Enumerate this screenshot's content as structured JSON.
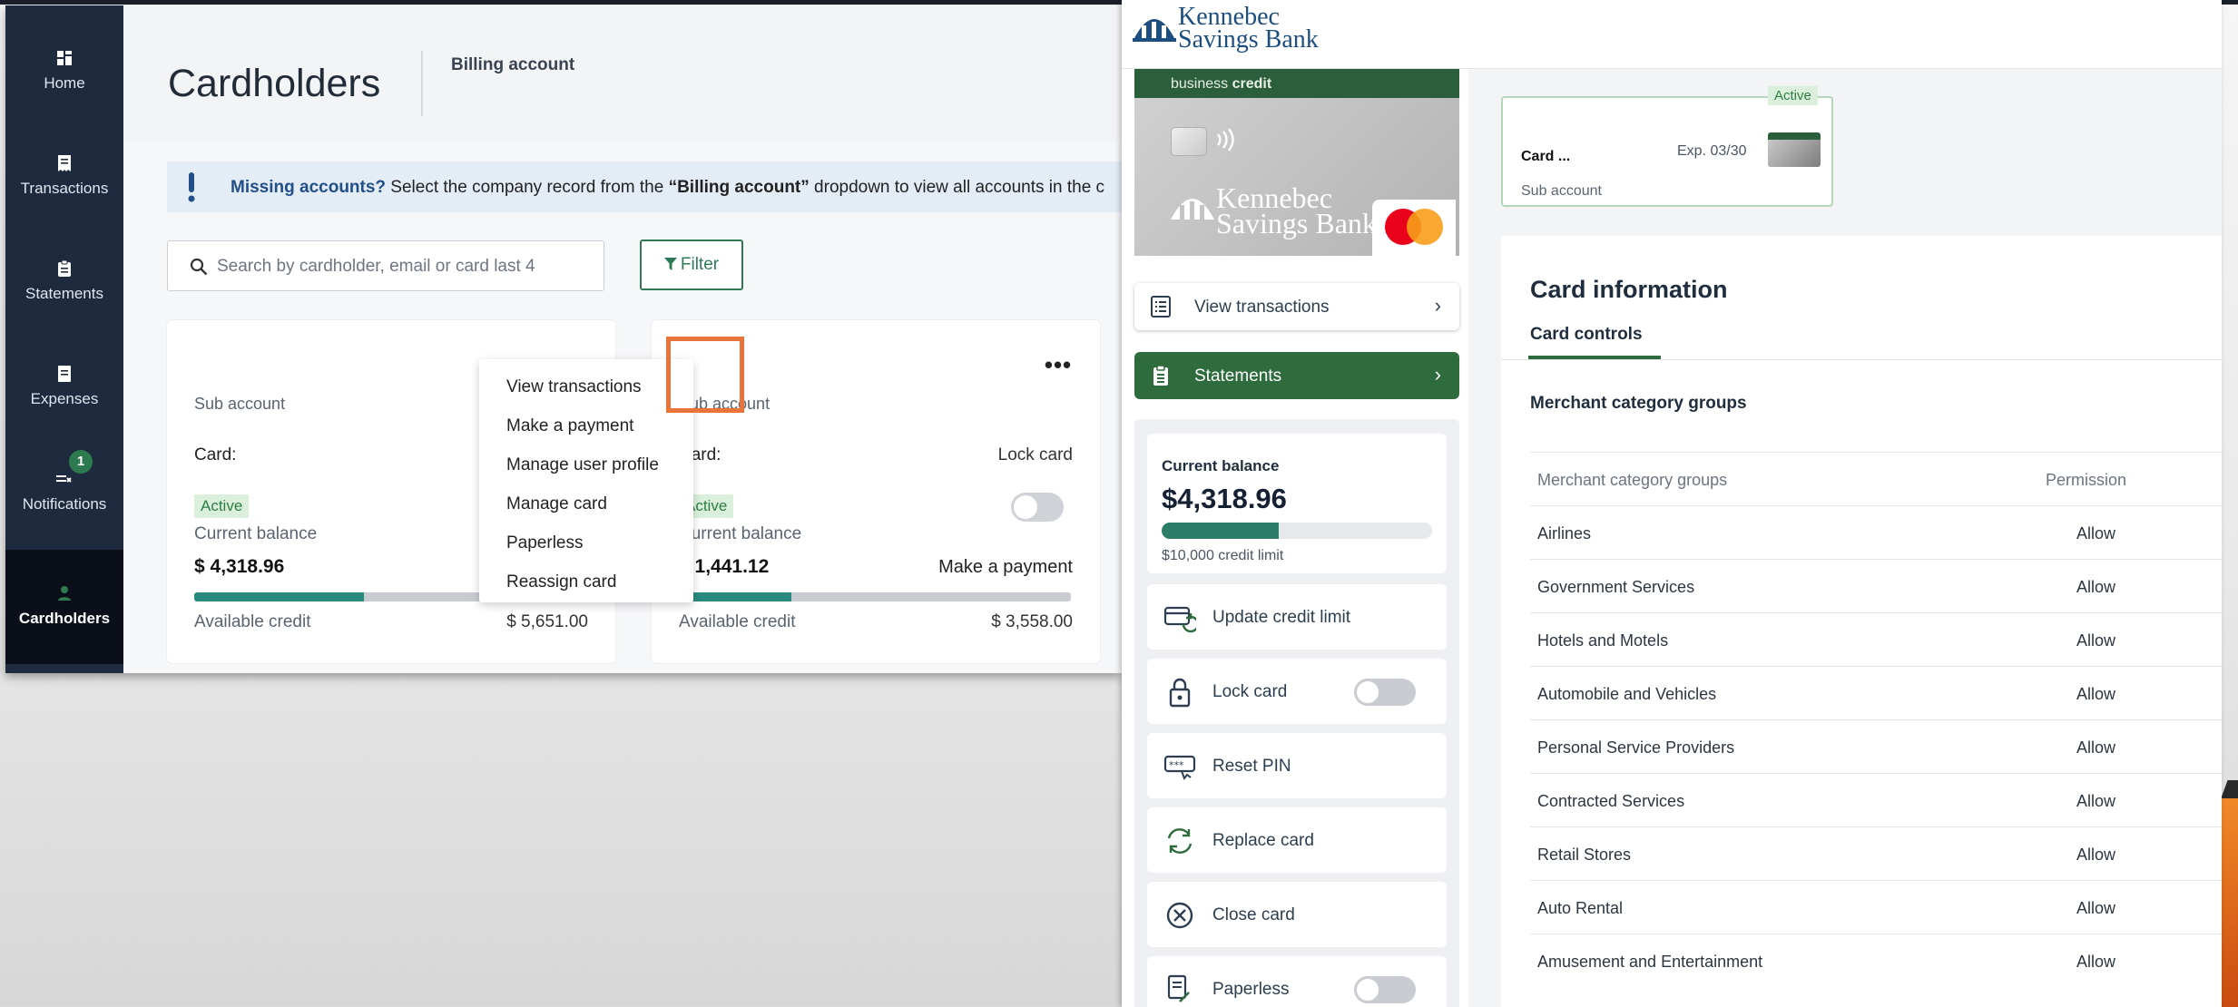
{
  "sidebar": {
    "items": [
      {
        "label": "Home",
        "icon": "dashboard-icon"
      },
      {
        "label": "Transactions",
        "icon": "receipt-icon"
      },
      {
        "label": "Statements",
        "icon": "clipboard-icon"
      },
      {
        "label": "Expenses",
        "icon": "document-icon"
      },
      {
        "label": "Notifications",
        "icon": "bell-list-icon",
        "badge": "1"
      },
      {
        "label": "Cardholders",
        "icon": "people-icon",
        "selected": true
      }
    ]
  },
  "header": {
    "title": "Cardholders",
    "billing_label": "Billing account"
  },
  "banner": {
    "bold1": "Missing accounts?",
    "text1": " Select the company record from the ",
    "bold2": "“Billing account”",
    "text2": " dropdown to view all accounts in the c"
  },
  "search": {
    "placeholder": "Search by cardholder, email or card last 4"
  },
  "filter": {
    "label": "Filter"
  },
  "cards": [
    {
      "sub": "Sub account",
      "card_label": "Card:",
      "lock_label": "ard",
      "status": "Active",
      "balance_label": "Current balance",
      "balance": "$ 4,318.96",
      "payment_label": "ent",
      "available_label": "Available credit",
      "available": "$ 5,651.00",
      "fill_fraction": 0.433
    },
    {
      "sub": "Sub account",
      "card_label": "Card:",
      "lock_label": "Lock card",
      "status": "Active",
      "balance_label": "Current balance",
      "balance": "$ 1,441.12",
      "payment_label": "Make a payment",
      "available_label": "Available credit",
      "available": "$ 3,558.00",
      "fill_fraction": 0.288
    }
  ],
  "menu": {
    "items": [
      "View transactions",
      "Make a payment",
      "Manage user profile",
      "Manage card",
      "Paperless",
      "Reassign card"
    ]
  },
  "more_label": "•••",
  "bank": {
    "name_line1": "Kennebec",
    "name_line2": "Savings Bank"
  },
  "credit_card": {
    "band_label": "business",
    "band_bold": "credit",
    "network": "mastercard"
  },
  "right_nav": {
    "view_transactions": "View transactions",
    "statements": "Statements",
    "chevron": "›"
  },
  "balance_tile": {
    "label": "Current balance",
    "value": "$4,318.96",
    "limit": "$10,000 credit limit",
    "fill_fraction": 0.432
  },
  "actions": [
    {
      "label": "Update credit limit",
      "icon": "credit-limit-icon",
      "toggle": false
    },
    {
      "label": "Lock card",
      "icon": "lock-icon",
      "toggle": true,
      "on": false
    },
    {
      "label": "Reset PIN",
      "icon": "pin-icon",
      "toggle": false
    },
    {
      "label": "Replace card",
      "icon": "replace-icon",
      "toggle": false
    },
    {
      "label": "Close card",
      "icon": "close-circle-icon",
      "toggle": false
    },
    {
      "label": "Paperless",
      "icon": "paperless-icon",
      "toggle": true,
      "on": false
    }
  ],
  "mini_card": {
    "status": "Active",
    "name": "Card ...",
    "expiry": "Exp. 03/30",
    "sub": "Sub account"
  },
  "card_info": {
    "title": "Card information",
    "tab": "Card controls",
    "section": "Merchant category groups",
    "table_headers": [
      "Merchant category groups",
      "Permission"
    ],
    "rows": [
      {
        "group": "Airlines",
        "permission": "Allow"
      },
      {
        "group": "Government Services",
        "permission": "Allow"
      },
      {
        "group": "Hotels and Motels",
        "permission": "Allow"
      },
      {
        "group": "Automobile and Vehicles",
        "permission": "Allow"
      },
      {
        "group": "Personal Service Providers",
        "permission": "Allow"
      },
      {
        "group": "Contracted Services",
        "permission": "Allow"
      },
      {
        "group": "Retail Stores",
        "permission": "Allow"
      },
      {
        "group": "Auto Rental",
        "permission": "Allow"
      },
      {
        "group": "Amusement and Entertainment",
        "permission": "Allow"
      }
    ]
  },
  "colors": {
    "sidebar": "#1e2a3e",
    "brand_green": "#2e6b3d",
    "highlight": "#e8743a",
    "progress": "#2b8a7e"
  }
}
